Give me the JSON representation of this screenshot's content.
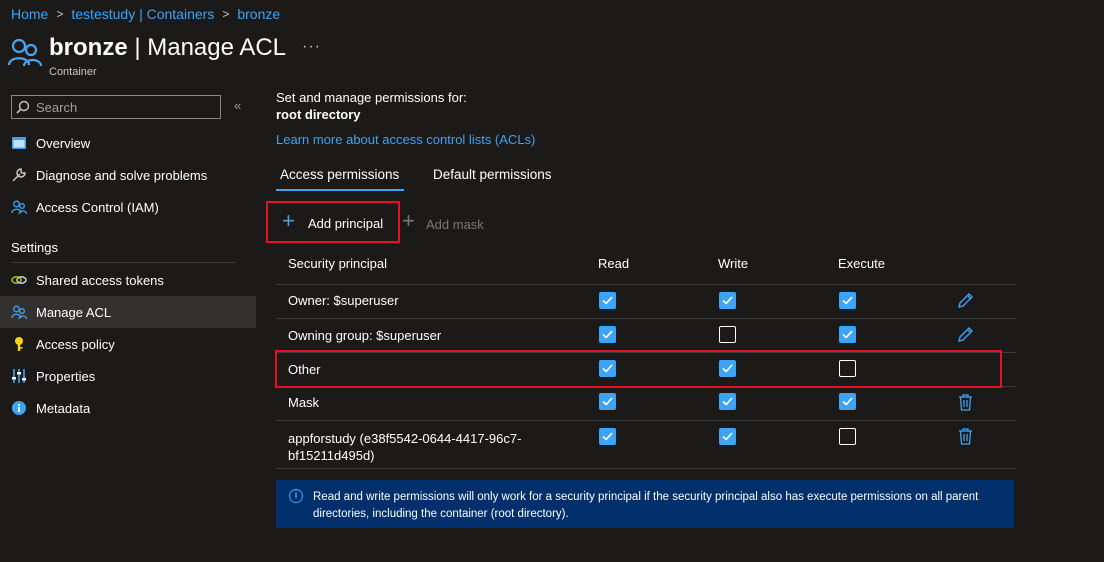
{
  "breadcrumb": {
    "home": "Home",
    "parent": "testestudy | Containers",
    "current": "bronze",
    "sep": ">"
  },
  "header": {
    "name": "bronze",
    "rest": " | Manage ACL",
    "subtitle": "Container",
    "more": "···"
  },
  "sidebar": {
    "search_placeholder": "Search",
    "collapse": "«",
    "items": [
      {
        "label": "Overview",
        "icon": "overview-icon"
      },
      {
        "label": "Diagnose and solve problems",
        "icon": "wrench-icon"
      },
      {
        "label": "Access Control (IAM)",
        "icon": "people-icon"
      }
    ],
    "settings_title": "Settings",
    "settings_items": [
      {
        "label": "Shared access tokens",
        "icon": "link-icon"
      },
      {
        "label": "Manage ACL",
        "icon": "people-icon",
        "active": true
      },
      {
        "label": "Access policy",
        "icon": "key-icon"
      },
      {
        "label": "Properties",
        "icon": "sliders-icon"
      },
      {
        "label": "Metadata",
        "icon": "info-icon"
      }
    ]
  },
  "main": {
    "intro": "Set and manage permissions for:",
    "target": "root directory",
    "learn_more": "Learn more about access control lists (ACLs)",
    "tabs": [
      {
        "label": "Access permissions",
        "active": true
      },
      {
        "label": "Default permissions"
      }
    ],
    "toolbar": {
      "add_principal": "Add principal",
      "add_mask": "Add mask"
    },
    "table": {
      "headers": [
        "Security principal",
        "Read",
        "Write",
        "Execute"
      ],
      "rows": [
        {
          "principal": "Owner: $superuser",
          "read": true,
          "write": true,
          "execute": true,
          "action": "edit-icon"
        },
        {
          "principal": "Owning group: $superuser",
          "read": true,
          "write": false,
          "execute": true,
          "action": "edit-icon"
        },
        {
          "principal": "Other",
          "read": true,
          "write": true,
          "execute": false,
          "action": ""
        },
        {
          "principal": "Mask",
          "read": true,
          "write": true,
          "execute": true,
          "action": "delete-icon"
        },
        {
          "principal": "appforstudy (e38f5542-0644-4417-96c7-",
          "principal2": "bf15211d495d)",
          "read": true,
          "write": true,
          "execute": false,
          "action": "delete-icon"
        }
      ]
    },
    "info_icon": "i",
    "info": "Read and write permissions will only work for a security principal if the security principal also has execute permissions on all parent directories, including the container (root directory)."
  },
  "colors": {
    "accent": "#3ea3f5",
    "highlight": "#e81123",
    "background": "#1b1a19",
    "info_bg": "#002f6c"
  }
}
